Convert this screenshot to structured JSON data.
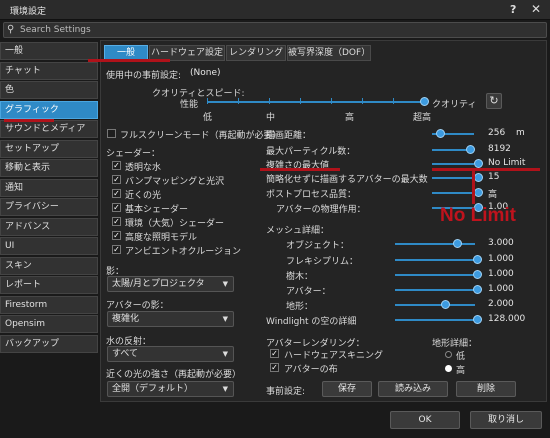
{
  "window": {
    "title": "環境設定",
    "help_icon": "?",
    "close_icon": "✕"
  },
  "search": {
    "placeholder": "Search Settings",
    "icon": "search-icon"
  },
  "sidebar": {
    "items": [
      {
        "label": "一般"
      },
      {
        "label": "チャット"
      },
      {
        "label": "色"
      },
      {
        "label": "グラフィック",
        "active": true
      },
      {
        "label": "サウンドとメディア"
      },
      {
        "label": "セットアップ"
      },
      {
        "label": "移動と表示"
      },
      {
        "label": "通知"
      },
      {
        "label": "プライバシー"
      },
      {
        "label": "アドバンス"
      },
      {
        "label": "UI"
      },
      {
        "label": "スキン"
      },
      {
        "label": "レポート"
      },
      {
        "label": "Firestorm"
      },
      {
        "label": "Opensim"
      },
      {
        "label": "バックアップ"
      }
    ]
  },
  "tabs": [
    {
      "label": "一般",
      "active": true
    },
    {
      "label": "ハードウェア設定"
    },
    {
      "label": "レンダリング"
    },
    {
      "label": "被写界深度（DOF）"
    }
  ],
  "preset": {
    "label": "使用中の事前設定:",
    "value": "(None)"
  },
  "quality": {
    "label": "クオリティとスピード:",
    "left_label": "性能",
    "right_label": "クオリティ",
    "ticks": [
      "低",
      "中",
      "高",
      "超高"
    ],
    "level": 1.0
  },
  "fullscreen": {
    "label": "フルスクリーンモード（再起動が必要）",
    "checked": false
  },
  "draw_distance": {
    "label": "描画距離：",
    "value": "256",
    "unit": "m"
  },
  "shaders": {
    "heading": "シェーダー：",
    "items": [
      {
        "label": "透明な水",
        "checked": true
      },
      {
        "label": "バンプマッピングと光沢",
        "checked": true
      },
      {
        "label": "近くの光",
        "checked": true
      },
      {
        "label": "基本シェーダー",
        "checked": true
      },
      {
        "label": "環境（大気）シェーダー",
        "checked": true
      },
      {
        "label": "高度な照明モデル",
        "checked": true
      },
      {
        "label": "アンビエントオクルージョン",
        "checked": true
      }
    ]
  },
  "right_settings": {
    "max_particles": {
      "label": "最大パーティクル数：",
      "value": "8192"
    },
    "max_complexity": {
      "label": "複雑さの最大値",
      "value": "No Limit"
    },
    "avatar_max_no_impostor": {
      "label": "簡略化せずに描画するアバターの最大数",
      "value": "15"
    },
    "post_process": {
      "label": "ポストプロセス品質：",
      "value": "高"
    },
    "avatar_physics": {
      "label": "アバターの物理作用：",
      "value": "1.00"
    }
  },
  "annotation": {
    "text": "No Limit"
  },
  "shadows": {
    "label": "影：",
    "value": "太陽/月とプロジェクタ"
  },
  "avatar_shadow": {
    "label": "アバターの影：",
    "value": "複雑化"
  },
  "water_reflection": {
    "label": "水の反射：",
    "value": "すべて"
  },
  "nearby_light": {
    "label": "近くの光の強さ（再起動が必要）",
    "value": "全開（デフォルト）"
  },
  "mesh": {
    "heading": "メッシュ詳細：",
    "items": [
      {
        "label": "オブジェクト：",
        "value": "3.000"
      },
      {
        "label": "フレキシプリム：",
        "value": "1.000"
      },
      {
        "label": "樹木：",
        "value": "1.000"
      },
      {
        "label": "アバター：",
        "value": "1.000"
      },
      {
        "label": "地形：",
        "value": "2.000"
      }
    ]
  },
  "windlight": {
    "label": "Windlight の空の詳細",
    "value": "128.000"
  },
  "avatar_render": {
    "heading": "アバターレンダリング：",
    "items": [
      {
        "label": "ハードウェアスキニング",
        "checked": true
      },
      {
        "label": "アバターの布",
        "checked": true
      }
    ]
  },
  "terrain_detail": {
    "heading": "地形詳細：",
    "options": [
      {
        "label": "低",
        "selected": false
      },
      {
        "label": "高",
        "selected": true
      }
    ]
  },
  "presets_bar": {
    "label": "事前設定:",
    "save": "保存",
    "load": "読み込み",
    "delete": "削除"
  },
  "footer": {
    "ok": "OK",
    "cancel": "取り消し"
  },
  "colors": {
    "accent": "#2f8ac6",
    "annotation": "#c0131d"
  }
}
